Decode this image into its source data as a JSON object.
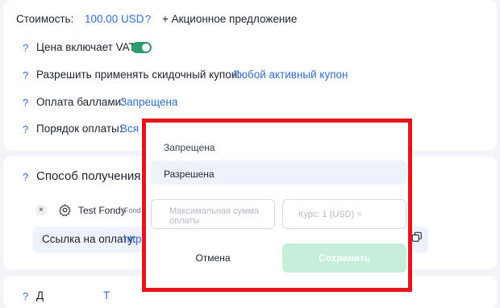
{
  "price": {
    "label": "Стоимость:",
    "value": "100.00 USD",
    "help": "?",
    "promo": "+ Акционное предложение"
  },
  "vat": {
    "help": "?",
    "label": "Цена включает VAT",
    "enabled": true
  },
  "coupon": {
    "help": "?",
    "label": "Разрешить применять скидочный купон:",
    "value": "Любой активный купон"
  },
  "points": {
    "help": "?",
    "label": "Оплата баллами:",
    "value": "Запрещена"
  },
  "order": {
    "help": "?",
    "label": "Порядок оплаты:",
    "value": "Вся с"
  },
  "delivery": {
    "help": "?",
    "label": "Способ получения о"
  },
  "gateway": {
    "close": "×",
    "name": "Test Fondy",
    "sub": "(Fond"
  },
  "payment_link": {
    "label": "Ссылка на оплату:",
    "value": "http"
  },
  "bottom": {
    "help": "?",
    "label": "Д",
    "value": "Т"
  },
  "popup": {
    "options": [
      "Запрещена",
      "Разрешена"
    ],
    "max_sum_placeholder": "Максимальная сумма оплаты",
    "rate_placeholder": "Курс: 1 (USD) =",
    "cancel": "Отмена",
    "save": "Сохранить"
  },
  "colors": {
    "accent": "#2f6fd6",
    "toggle": "#2e9c6c",
    "highlight": "#e8141c",
    "save_bg": "#c6eedb"
  }
}
